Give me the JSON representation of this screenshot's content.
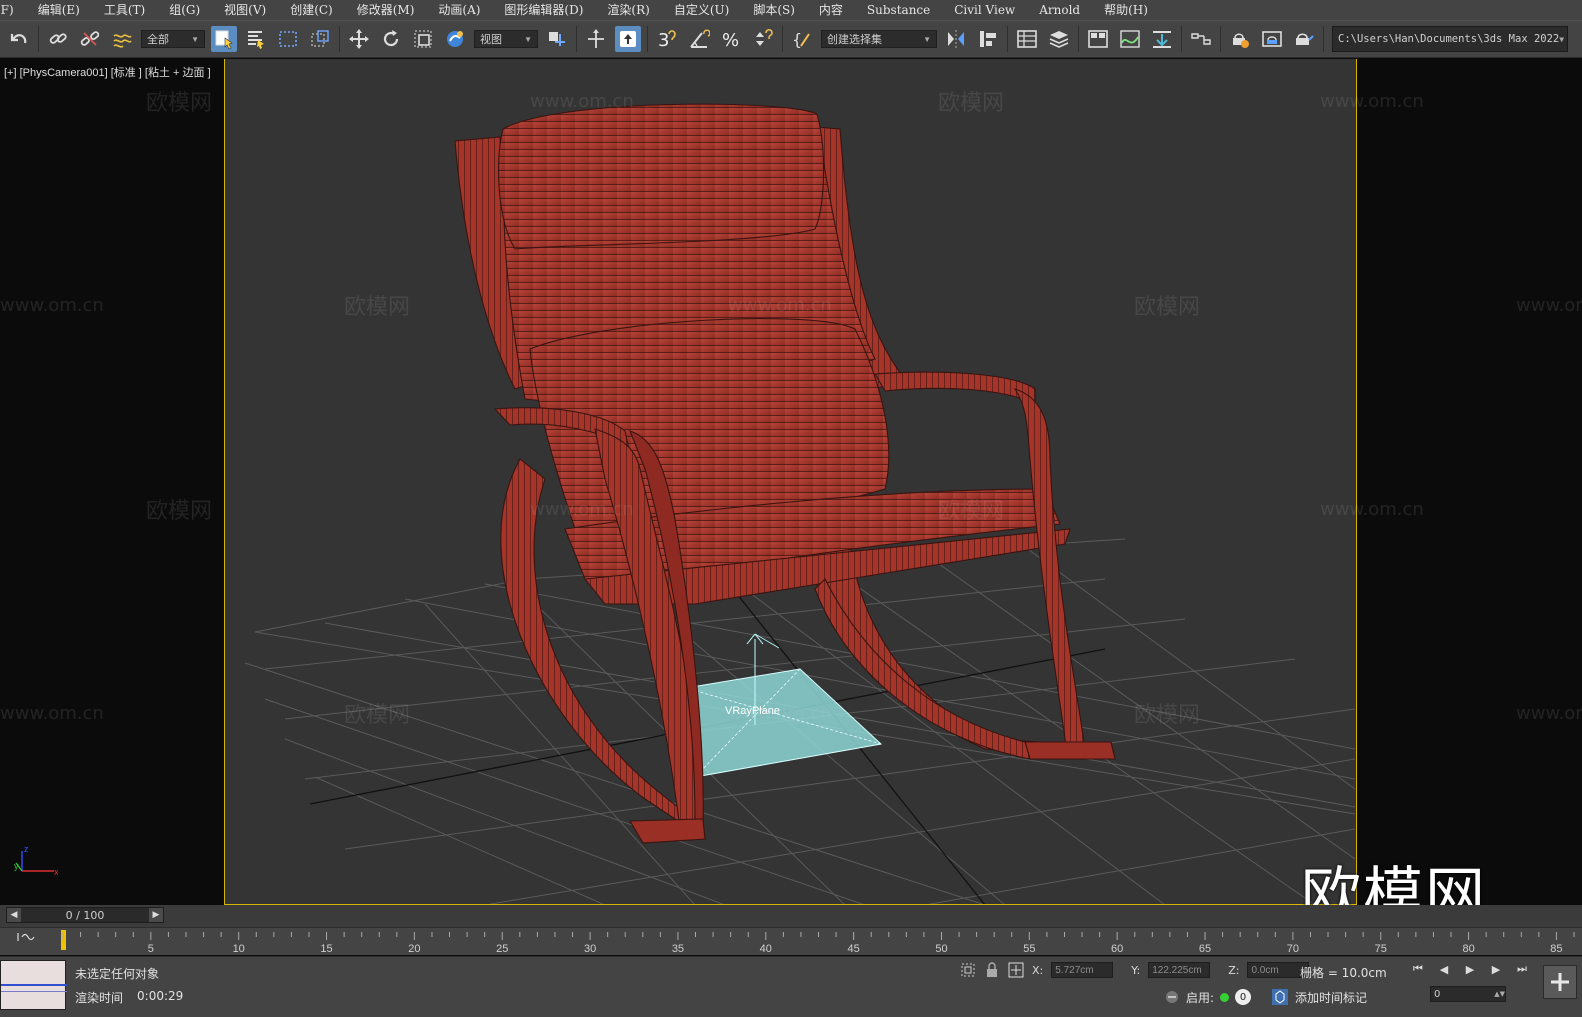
{
  "menu": [
    "(F)",
    "编辑(E)",
    "工具(T)",
    "组(G)",
    "视图(V)",
    "创建(C)",
    "修改器(M)",
    "动画(A)",
    "图形编辑器(D)",
    "渲染(R)",
    "自定义(U)",
    "脚本(S)",
    "内容",
    "Substance",
    "Civil View",
    "Arnold",
    "帮助(H)"
  ],
  "toolbar": {
    "filter_value": "全部",
    "ref_coord_value": "视图",
    "selection_set_value": "创建选择集",
    "project_path": "C:\\Users\\Han\\Documents\\3ds Max 2022",
    "spinner_snap_label": "3",
    "icons": [
      "undo-icon",
      "link-icon",
      "unlink-icon",
      "bind-spacewarp-icon",
      "select-object-icon",
      "select-by-name-icon",
      "rect-selection-icon",
      "window-crossing-icon",
      "move-icon",
      "rotate-icon",
      "scale-icon",
      "placement-icon",
      "pivot-icon",
      "keyboard-shortcut-icon",
      "snap-3d-icon",
      "angle-snap-icon",
      "percent-snap-icon",
      "spinner-snap-icon",
      "edit-named-sets-icon",
      "mirror-icon",
      "align-icon",
      "scene-explorer-icon",
      "layer-explorer-icon",
      "ribbon-icon",
      "curve-editor-icon",
      "schematic-view-icon",
      "material-editor-icon",
      "render-setup-icon",
      "render-frame-icon",
      "render-icon"
    ]
  },
  "viewport": {
    "label": "[+] [PhysCamera001] [标准 ] [粘土 + 边面 ]",
    "object_label": "VRayPlane",
    "watermark_text": "欧模网",
    "watermark_url": "www.om.cn",
    "logo_text": "欧模网",
    "colors": {
      "background": "#343434",
      "chair": "#a8352c",
      "frame": "#d7b600",
      "plane": "#8ed6d6"
    }
  },
  "timeline": {
    "slider_value": "0 / 100",
    "ticks": [
      "5",
      "10",
      "15",
      "20",
      "25",
      "30",
      "35",
      "40",
      "45",
      "50",
      "55",
      "60",
      "65",
      "70",
      "75",
      "80",
      "85"
    ]
  },
  "status": {
    "selection": "未选定任何对象",
    "render_time_label": "渲染时间",
    "render_time_value": "0:00:29",
    "x_label": "X:",
    "x_value": "5.727cm",
    "y_label": "Y:",
    "y_value": "122.225cm",
    "z_label": "Z:",
    "z_value": "0.0cm",
    "grid": "栅格 = 10.0cm",
    "enable_label": "启用:",
    "add_time_tag": "添加时间标记",
    "frame_value": "0",
    "enable_count": "0"
  }
}
